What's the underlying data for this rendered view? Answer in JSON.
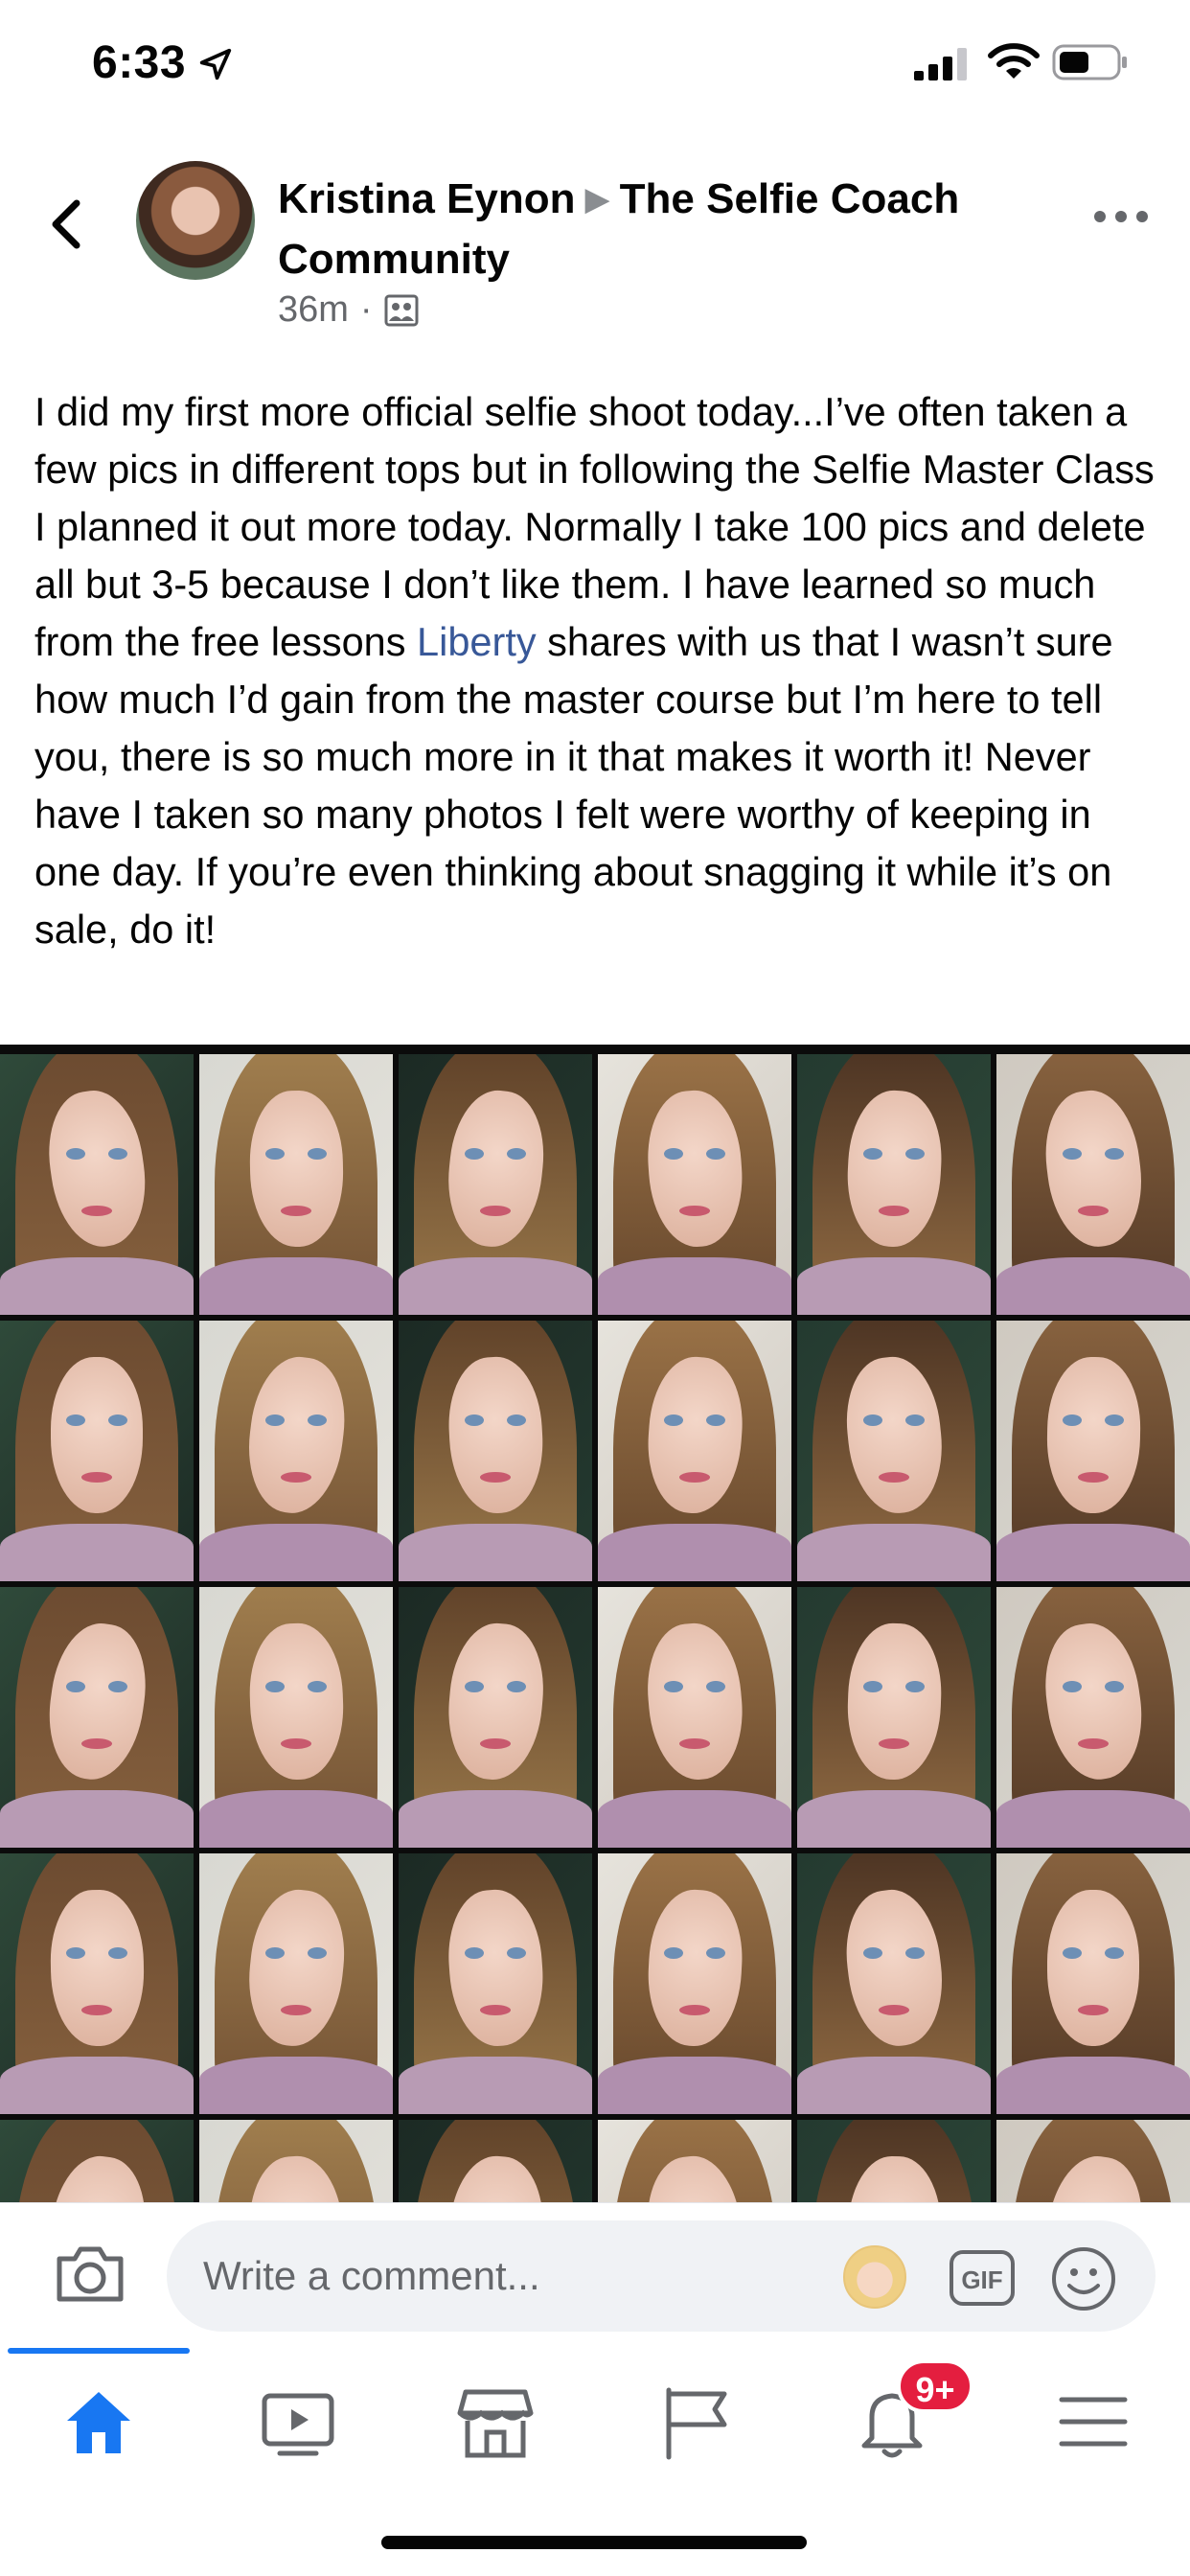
{
  "status_bar": {
    "time": "6:33",
    "icons": [
      "location-arrow-icon",
      "cellular-signal-icon",
      "wifi-icon",
      "battery-icon"
    ]
  },
  "post": {
    "author": "Kristina Eynon",
    "group": "The Selfie Coach Community",
    "time_ago": "36m",
    "meta_separator": "·",
    "body_before_mention": "I did my first more official selfie shoot today...I’ve often taken a few pics in different tops but in following the Selfie Master Class I planned it out more today. Normally I take 100 pics and delete all but 3-5 because I don’t like them. I have learned so much from the free lessons ",
    "mention": "Liberty",
    "body_after_mention": " shares with us that I wasn’t sure how much I’d gain from the master course but I’m here to tell you, there is so much more in it that makes it worth it! Never have I taken so many photos I felt were worthy of keeping in one day. If you’re even thinking about snagging it while it’s on sale, do it!",
    "collage": {
      "columns": 6,
      "rows_visible": 5,
      "tile_count": 30
    }
  },
  "comment_bar": {
    "placeholder": "Write a comment..."
  },
  "tab_bar": {
    "active_tab": "home",
    "tabs": [
      "home",
      "watch",
      "marketplace",
      "pages",
      "notifications",
      "menu"
    ],
    "notifications_badge": "9+"
  },
  "colors": {
    "accent": "#1877f2",
    "mention": "#385898",
    "badge": "#e41e3f",
    "secondary_text": "#65676b"
  }
}
